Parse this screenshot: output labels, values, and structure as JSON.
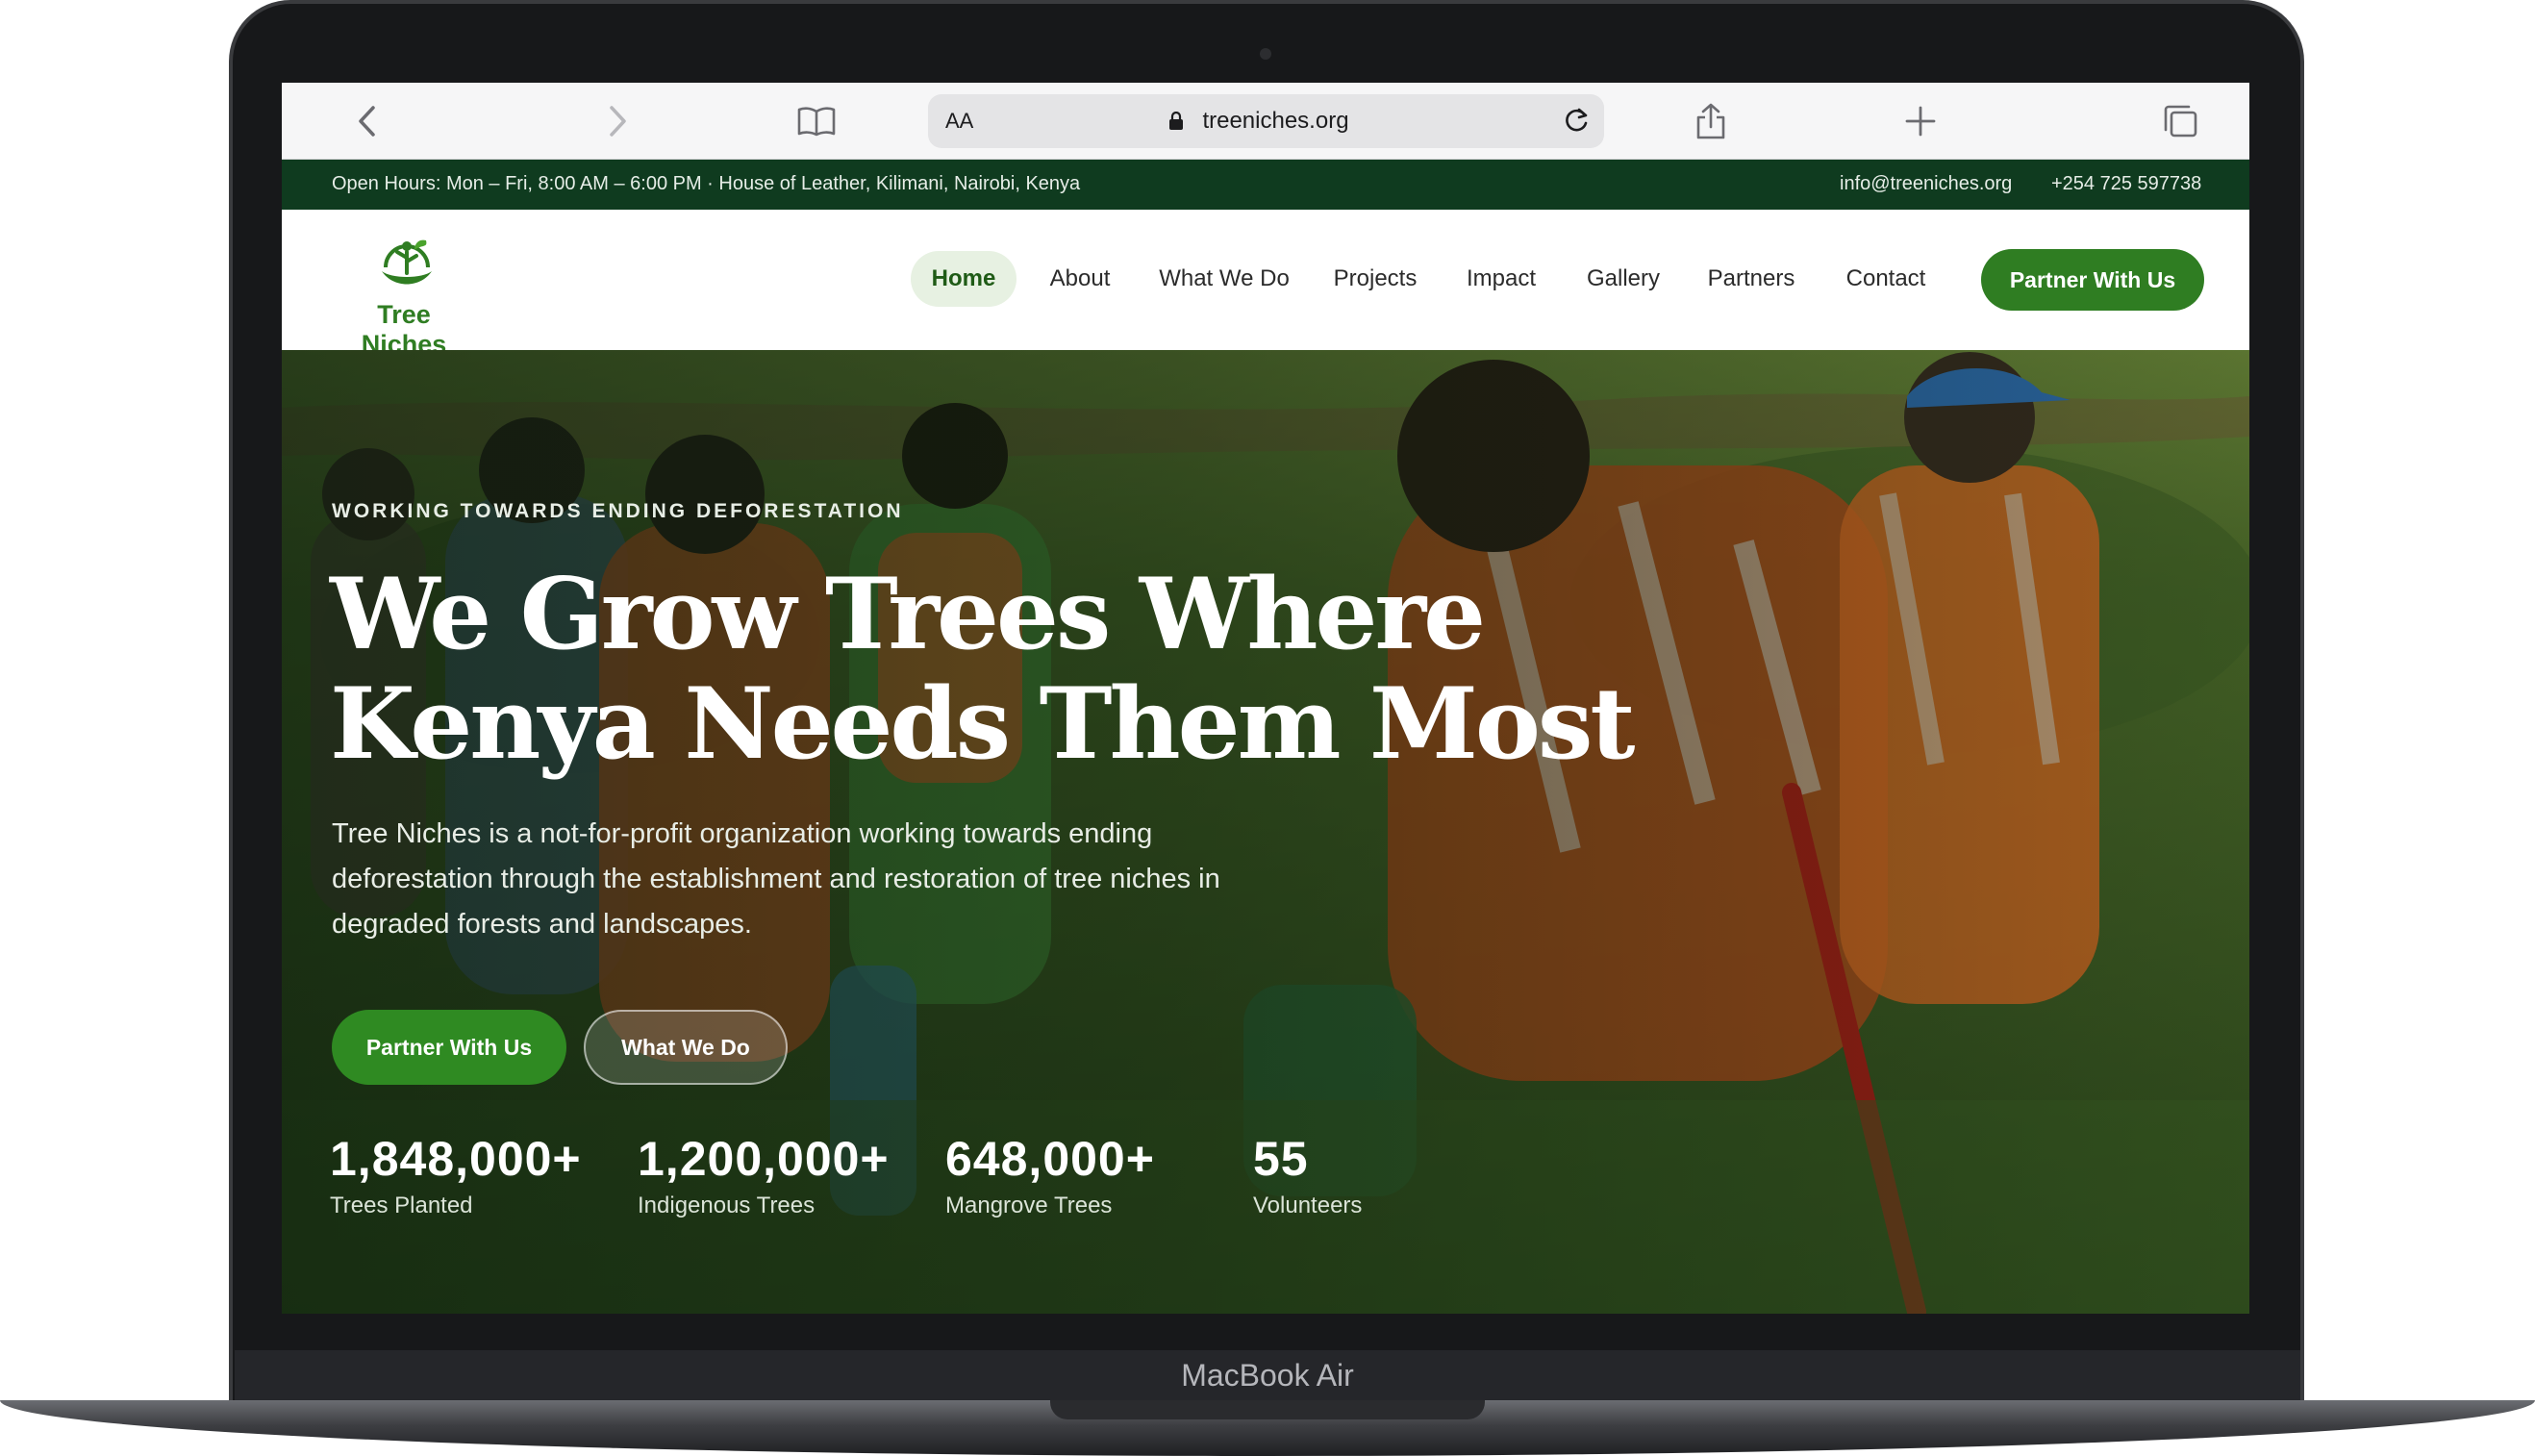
{
  "device": {
    "model_label": "MacBook Air"
  },
  "browser": {
    "address_text": "treeniches.org",
    "reader_label": "AA"
  },
  "topbar": {
    "info": "Open Hours: Mon – Fri, 8:00 AM – 6:00 PM · House of Leather, Kilimani, Nairobi, Kenya",
    "email": "info@treeniches.org",
    "phone": "+254 725 597738"
  },
  "site": {
    "logo_text": "Tree Niches",
    "brand_color": "#2f7d22",
    "dark_color": "#0f3b1f"
  },
  "nav": {
    "items": [
      "Home",
      "About",
      "What We Do",
      "Projects",
      "Impact",
      "Gallery",
      "Partners",
      "Contact"
    ],
    "active": "Home",
    "cta": "Partner With Us"
  },
  "hero": {
    "eyebrow": "WORKING TOWARDS ENDING DEFORESTATION",
    "title_line1": "We Grow Trees Where",
    "title_line2": "Kenya Needs Them Most",
    "description": "Tree Niches is a not-for-profit organization working towards ending deforestation through the establishment and restoration of tree niches in degraded forests and landscapes.",
    "primary_button": "Partner With Us",
    "secondary_button": "What We Do"
  },
  "stats": [
    {
      "value": "1,848,000+",
      "label": "Trees Planted"
    },
    {
      "value": "1,200,000+",
      "label": "Indigenous Trees"
    },
    {
      "value": "648,000+",
      "label": "Mangrove Trees"
    },
    {
      "value": "55",
      "label": "Volunteers"
    }
  ]
}
